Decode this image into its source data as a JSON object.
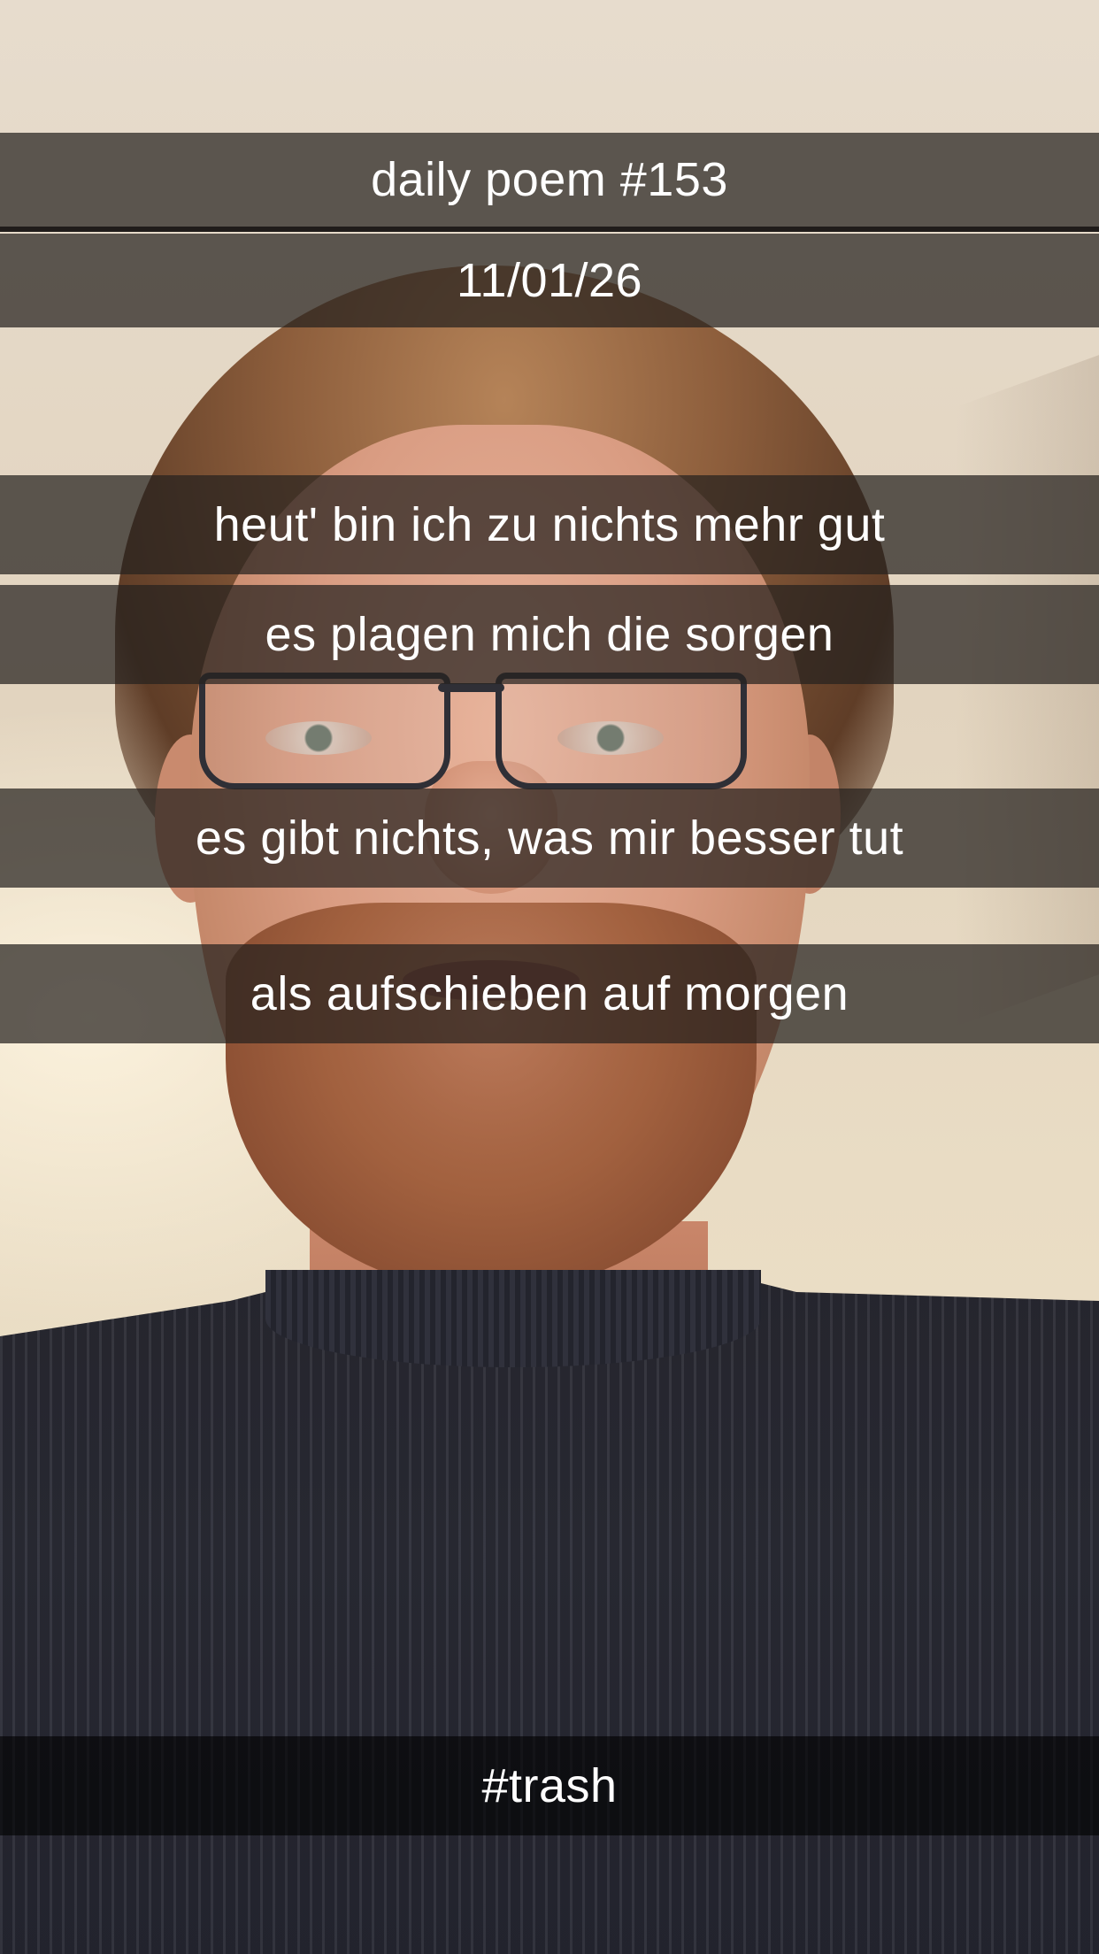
{
  "snap": {
    "title": "daily poem #153",
    "date": "11/01/26",
    "lines": [
      "heut' bin ich zu nichts mehr gut",
      "es plagen mich die sorgen",
      "es gibt nichts, was mir besser tut",
      "als aufschieben auf morgen"
    ],
    "tag": "#trash"
  },
  "colors": {
    "caption_bar": "#26211e",
    "caption_text": "#ffffff",
    "wall": "#e6d9c5",
    "sweater": "#2a2a33"
  }
}
